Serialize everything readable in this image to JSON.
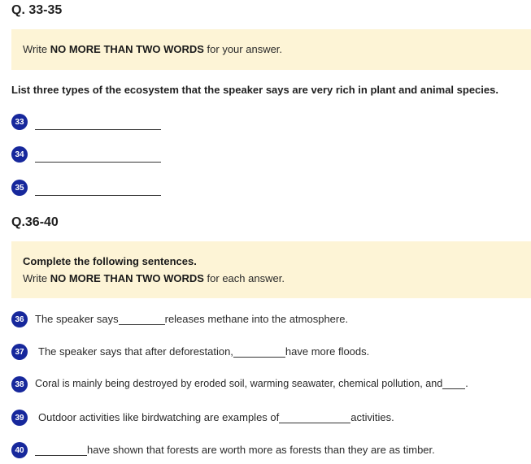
{
  "section1": {
    "heading": "Q. 33-35",
    "instruction_pre": "Write ",
    "instruction_bold": "NO MORE THAN TWO WORDS",
    "instruction_post": " for your answer.",
    "question": "List three types of the ecosystem that the speaker says are very rich in plant and animal species.",
    "items": [
      {
        "number": "33"
      },
      {
        "number": "34"
      },
      {
        "number": "35"
      }
    ]
  },
  "section2": {
    "heading": "Q.36-40",
    "instruction_line1": "Complete the following sentences.",
    "instruction_pre": "Write ",
    "instruction_bold": "NO MORE THAN TWO WORDS",
    "instruction_post": " for each answer.",
    "items": [
      {
        "number": "36",
        "before": "The speaker says",
        "after": "releases methane into the atmosphere."
      },
      {
        "number": "37",
        "before": "The speaker says that after deforestation,",
        "after": "have more floods."
      },
      {
        "number": "38",
        "before": "Coral is mainly being destroyed by eroded soil, warming seawater, chemical pollution, and",
        "after": "."
      },
      {
        "number": "39",
        "before": "Outdoor activities like birdwatching are examples of",
        "after": "activities."
      },
      {
        "number": "40",
        "before": "",
        "after": "have shown that forests are worth more as forests than they are as timber."
      }
    ]
  }
}
